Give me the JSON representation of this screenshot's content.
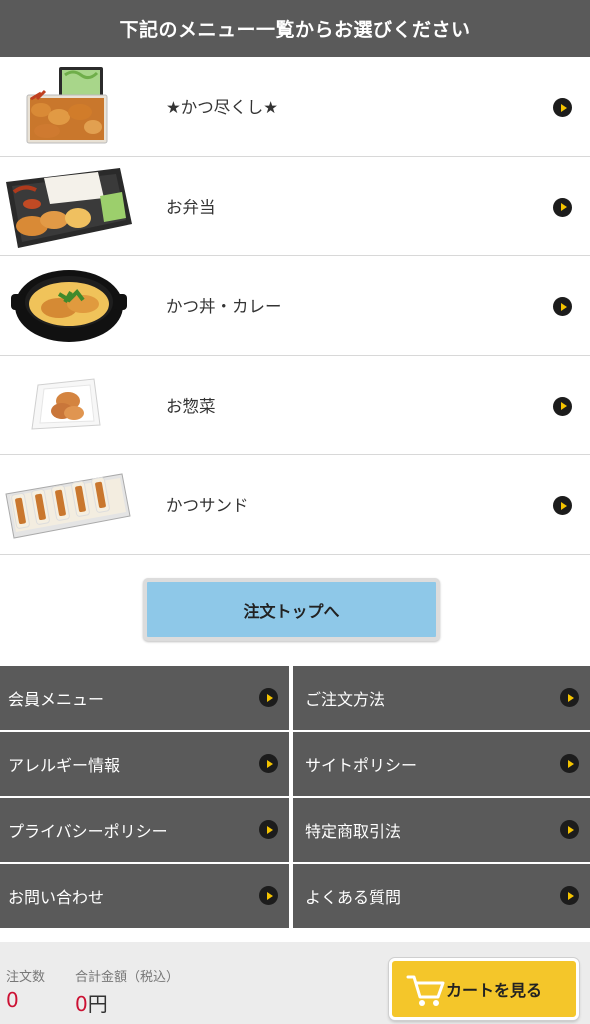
{
  "header": {
    "title": "下記のメニュー一覧からお選びください"
  },
  "menu": [
    {
      "label": "★かつ尽くし★",
      "icon": "katsu-assortment-thumbnail"
    },
    {
      "label": "お弁当",
      "icon": "bento-box-thumbnail"
    },
    {
      "label": "かつ丼・カレー",
      "icon": "katsudon-bowl-thumbnail"
    },
    {
      "label": "お惣菜",
      "icon": "side-dish-thumbnail"
    },
    {
      "label": "かつサンド",
      "icon": "katsu-sandwich-thumbnail"
    }
  ],
  "order_top": {
    "label": "注文トップへ"
  },
  "nav": [
    {
      "label": "会員メニュー"
    },
    {
      "label": "ご注文方法"
    },
    {
      "label": "アレルギー情報"
    },
    {
      "label": "サイトポリシー"
    },
    {
      "label": "プライバシーポリシー"
    },
    {
      "label": "特定商取引法"
    },
    {
      "label": "お問い合わせ"
    },
    {
      "label": "よくある質問"
    }
  ],
  "footer": {
    "order_count_label": "注文数",
    "order_count_value": "0",
    "total_label": "合計金額（税込）",
    "total_value": "0",
    "total_unit": "円",
    "cart_label": "カートを見る"
  },
  "colors": {
    "header_bg": "#5a5a5a",
    "nav_bg": "#5a5a5a",
    "order_button_bg": "#8ec8e8",
    "cart_button_bg": "#f4c62a",
    "arrow_icon_fill": "#f5c400",
    "price_red": "#cc1133"
  }
}
